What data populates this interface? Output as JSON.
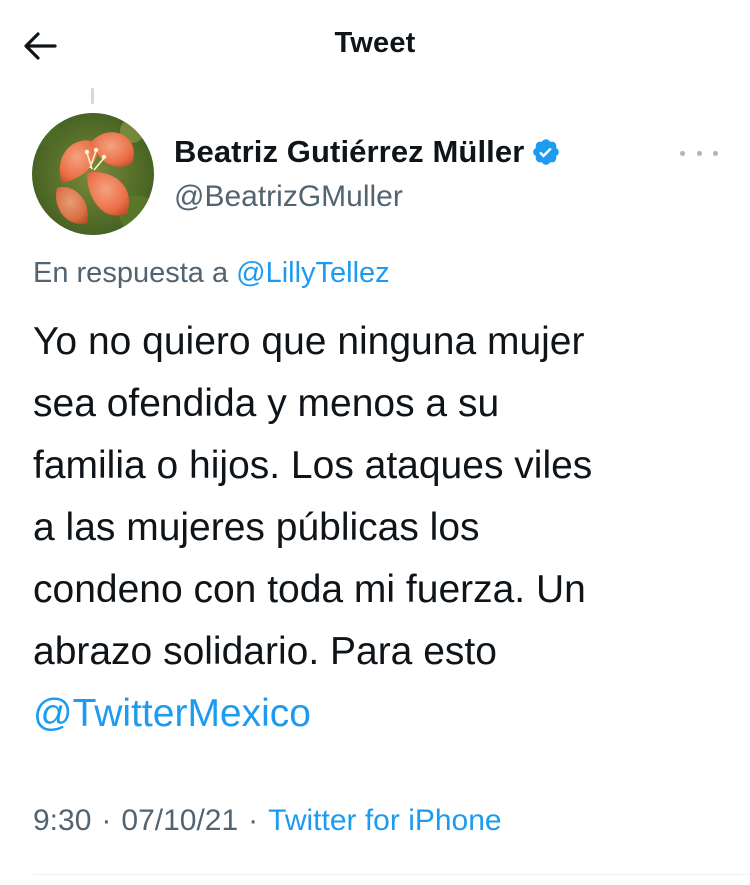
{
  "header": {
    "title": "Tweet",
    "back_icon": "arrow-left-icon"
  },
  "author": {
    "name": "Beatriz Gutiérrez Müller",
    "handle": "@BeatrizGMuller",
    "verified": true,
    "verified_icon": "verified-badge-icon",
    "avatar_icon": "flower-avatar"
  },
  "reply_to": {
    "prefix": "En respuesta a",
    "mention": "@LillyTellez"
  },
  "tweet": {
    "lines": [
      "Yo no quiero que ninguna mujer",
      "sea ofendida y menos a su",
      "familia o hijos. Los ataques viles",
      "a las mujeres públicas los",
      "condeno con toda mi fuerza. Un",
      "abrazo solidario. Para esto"
    ],
    "mention": "@TwitterMexico"
  },
  "meta": {
    "time": "9:30",
    "separator": "·",
    "date": "07/10/21",
    "source": "Twitter for iPhone"
  },
  "colors": {
    "accent": "#1d9bf0",
    "text": "#0f1419",
    "secondary": "#536471"
  }
}
